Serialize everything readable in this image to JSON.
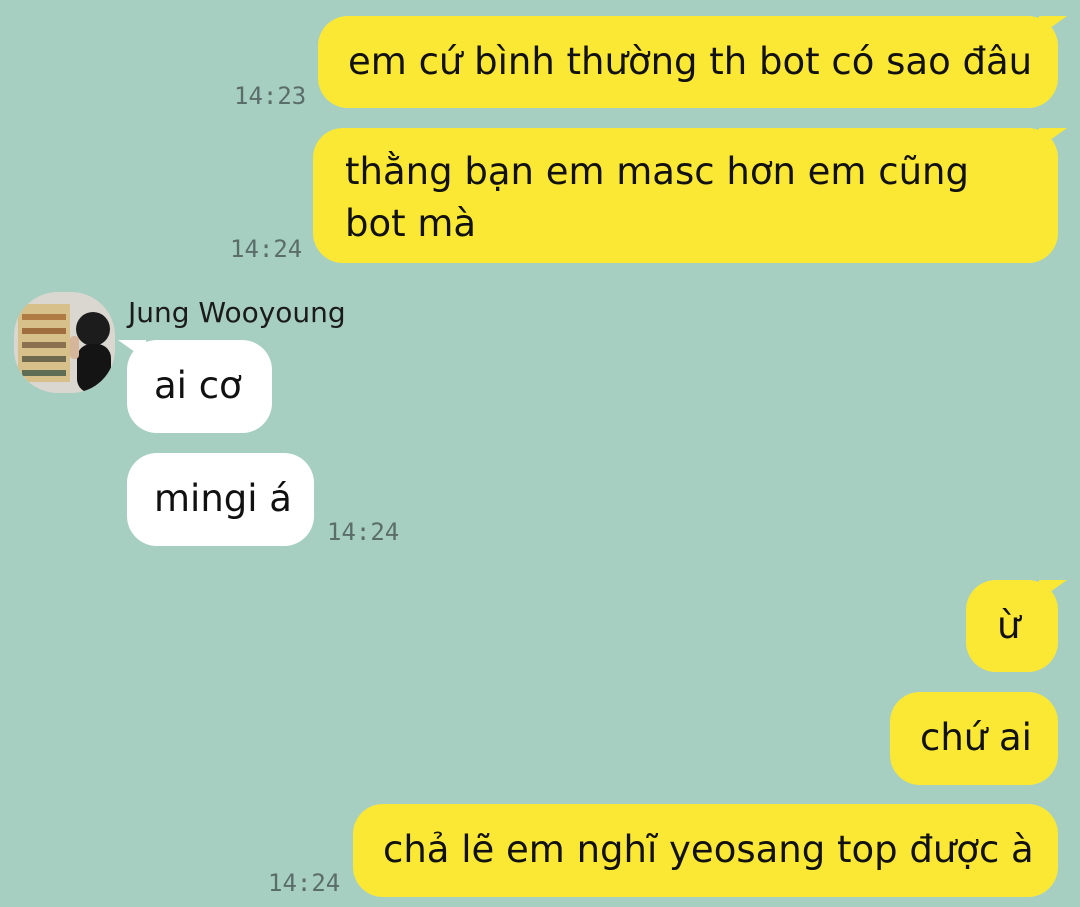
{
  "contact": {
    "name": "Jung Wooyoung"
  },
  "messages": [
    {
      "text": "em cứ bình thường th bot có sao đâu",
      "time": "14:23"
    },
    {
      "text": "thằng bạn em masc hơn em cũng bot mà",
      "time": "14:24"
    },
    {
      "text": "ai cơ"
    },
    {
      "text": "mingi á",
      "time": "14:24"
    },
    {
      "text": "ừ"
    },
    {
      "text": "chứ ai"
    },
    {
      "text": "chả lẽ em nghĩ yeosang top được à",
      "time": "14:24"
    }
  ],
  "colors": {
    "background": "#a6cfc2",
    "outgoing_bubble": "#fbe834",
    "incoming_bubble": "#ffffff",
    "timestamp": "#5b6d68"
  },
  "icons": {
    "avatar": "contact-avatar-photo"
  }
}
